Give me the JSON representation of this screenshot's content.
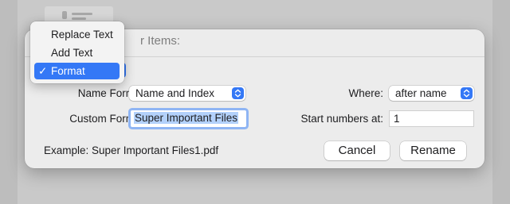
{
  "dialog": {
    "title_fragment": "r Items:",
    "name_format": {
      "label": "Name Format:",
      "value": "Name and Index"
    },
    "where": {
      "label": "Where:",
      "value": "after name"
    },
    "custom_format": {
      "label": "Custom Format:",
      "value": "Super Important Files"
    },
    "start_numbers": {
      "label": "Start numbers at:",
      "value": "1"
    },
    "example": "Example: Super Important Files1.pdf",
    "cancel_label": "Cancel",
    "rename_label": "Rename"
  },
  "menu": {
    "items": [
      {
        "label": "Replace Text",
        "selected": false
      },
      {
        "label": "Add Text",
        "selected": false
      },
      {
        "label": "Format",
        "selected": true
      }
    ],
    "check_icon": "checkmark-icon"
  },
  "colors": {
    "accent": "#3478f6",
    "focus_ring": "#8fb5f4",
    "dialog_bg": "#ececec",
    "backdrop": "#bdbdbd"
  }
}
